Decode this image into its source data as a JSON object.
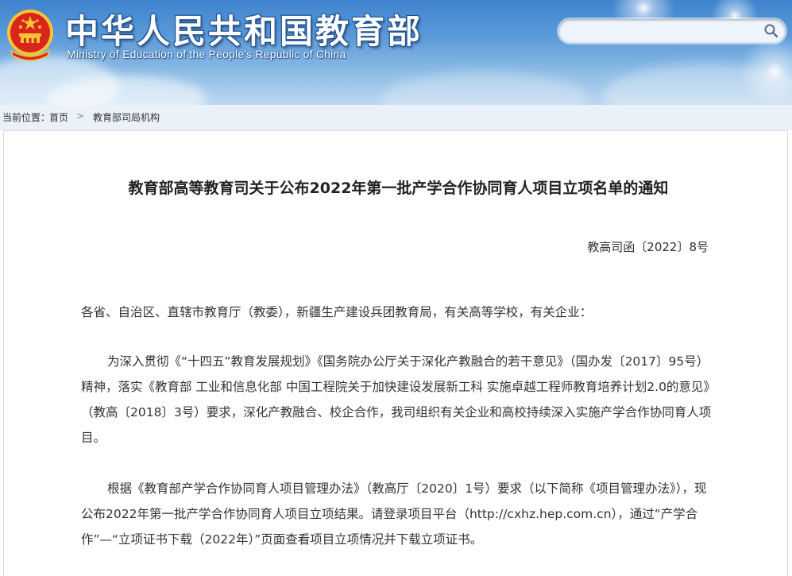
{
  "header": {
    "title": "中华人民共和国教育部",
    "subtitle": "Ministry of Education of the People's Republic of China",
    "search_placeholder": ""
  },
  "breadcrumb": {
    "prefix": "当前位置：",
    "home": "首页",
    "separator": ">",
    "current": "教育部司局机构"
  },
  "document": {
    "title": "教育部高等教育司关于公布2022年第一批产学合作协同育人项目立项名单的通知",
    "number": "教高司函〔2022〕8号",
    "salutation": "各省、自治区、直辖市教育厅（教委），新疆生产建设兵团教育局，有关高等学校，有关企业：",
    "paragraph1": "为深入贯彻《“十四五”教育发展规划》《国务院办公厅关于深化产教融合的若干意见》（国办发〔2017〕95号）精神，落实《教育部 工业和信息化部 中国工程院关于加快建设发展新工科 实施卓越工程师教育培养计划2.0的意见》（教高〔2018〕3号）要求，深化产教融合、校企合作，我司组织有关企业和高校持续深入实施产学合作协同育人项目。",
    "paragraph2": "根据《教育部产学合作协同育人项目管理办法》（教高厅〔2020〕1号）要求（以下简称《项目管理办法》），现公布2022年第一批产学合作协同育人项目立项结果。请登录项目平台（http://cxhz.hep.com.cn），通过“产学合作”—“立项证书下载（2022年）”页面查看项目立项情况并下载立项证书。"
  },
  "icons": {
    "emblem": "national-emblem-icon",
    "search": "search-icon"
  },
  "colors": {
    "header_top": "#3f84cf",
    "header_bottom": "#bcd7ef",
    "breadcrumb_bg": "#eaf1f8",
    "emblem_red": "#d8261c",
    "emblem_gold": "#f3c433"
  }
}
